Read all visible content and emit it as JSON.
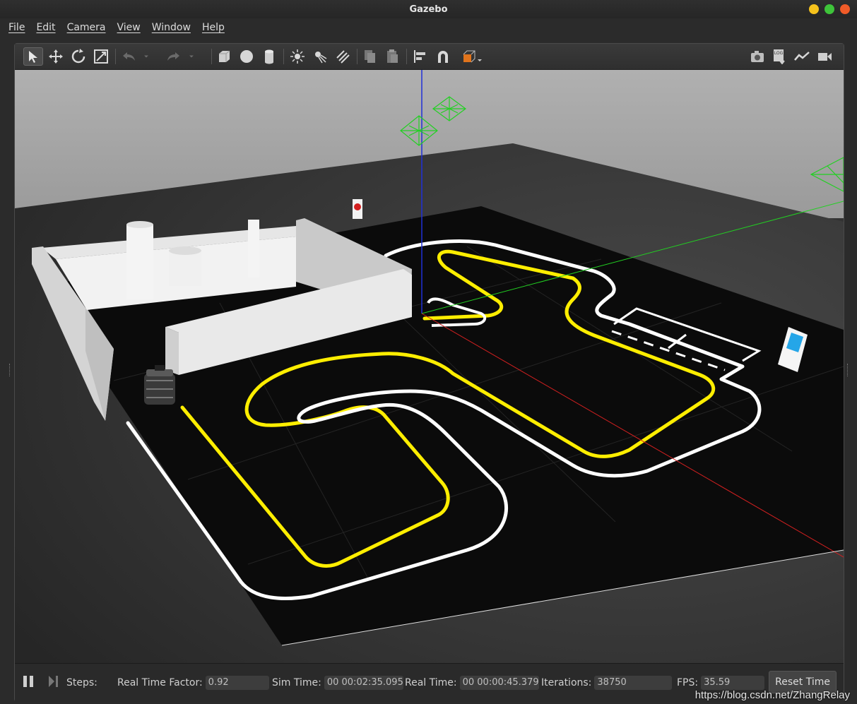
{
  "window": {
    "title": "Gazebo",
    "controls": [
      {
        "name": "minimize",
        "color": "#f5c21c"
      },
      {
        "name": "maximize",
        "color": "#3ec43a"
      },
      {
        "name": "close",
        "color": "#f05b28"
      }
    ]
  },
  "menu": [
    "File",
    "Edit",
    "Camera",
    "View",
    "Window",
    "Help"
  ],
  "toolbar": {
    "left_tools": [
      "select-icon",
      "translate-icon",
      "rotate-icon",
      "scale-icon",
      "undo-icon",
      "undo-dropdown-icon",
      "redo-icon",
      "redo-dropdown-icon",
      "box-icon",
      "sphere-icon",
      "cylinder-icon",
      "point-light-icon",
      "spot-light-icon",
      "directional-light-icon",
      "copy-icon",
      "paste-icon",
      "align-icon",
      "snap-icon",
      "view-angle-icon"
    ],
    "right_tools": [
      "screenshot-icon",
      "log-icon",
      "plot-icon",
      "record-video-icon"
    ],
    "log_icon_text": "LOG"
  },
  "statusbar": {
    "steps_label": "Steps:",
    "real_time_factor_label": "Real Time Factor:",
    "real_time_factor": "0.92",
    "sim_time_label": "Sim Time:",
    "sim_time": "00 00:02:35.095",
    "real_time_label": "Real Time:",
    "real_time": "00 00:00:45.379",
    "iterations_label": "Iterations:",
    "iterations": "38750",
    "fps_label": "FPS:",
    "fps": "35.59",
    "reset_label": "Reset Time"
  },
  "watermark": "https://blog.csdn.net/ZhangRelay",
  "scene_colors": {
    "sky": "#a9a9a9",
    "floor": "#3a3a3a",
    "track": "#0d0d0d",
    "yellow_line": "#ffee00",
    "white_line": "#ffffff",
    "x_axis": "#d42020",
    "y_axis": "#22d022",
    "z_axis": "#2030d8"
  }
}
